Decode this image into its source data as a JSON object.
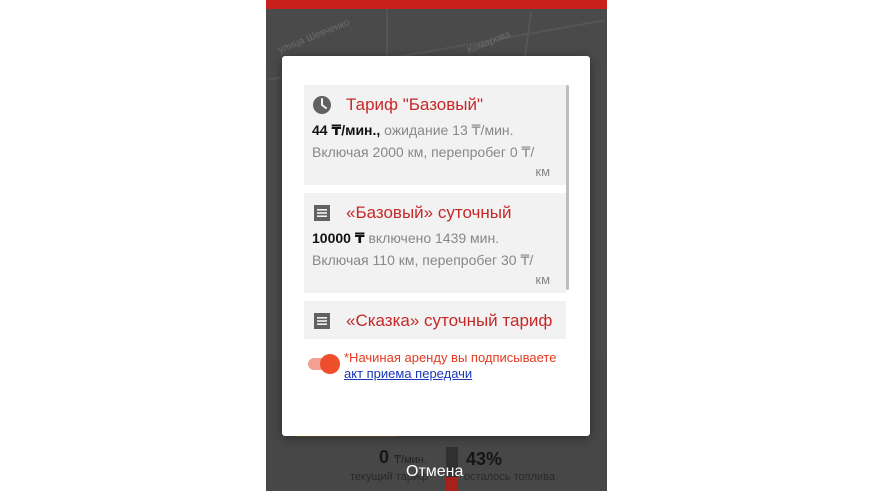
{
  "map": {
    "street_1": "улица Шевченко",
    "street_2": "Комарова"
  },
  "bottom_panel": {
    "speed_value": "0",
    "speed_unit": "₸/мин.",
    "speed_caption": "текущий тариф",
    "fuel_value": "43%",
    "fuel_caption": "осталось топлива"
  },
  "dialog": {
    "tariffs": [
      {
        "icon": "clock-icon",
        "title": "Тариф \"Базовый\"",
        "price_bold": "44 ₸/мин.,",
        "price_rest": " ожидание 13 ₸/мин.",
        "details_main": "Включая 2000 км, перепробег 0 ₸/",
        "details_unit": "км"
      },
      {
        "icon": "list-icon",
        "title": "«Базовый» суточный",
        "price_bold": "10000 ₸",
        "price_rest": " включено 1439 мин.",
        "details_main": "Включая 110 км, перепробег 30 ₸/",
        "details_unit": "км"
      },
      {
        "icon": "list-icon",
        "title": "«Сказка» суточный тариф"
      }
    ],
    "agreement_text": "*Начиная аренду вы подписываете",
    "agreement_link": "акт приема передачи",
    "toggle_on": true
  },
  "cancel_label": "Отмена",
  "colors": {
    "accent_red": "#c62828",
    "toggle": "#ef4e2d",
    "link": "#1a37b8"
  }
}
